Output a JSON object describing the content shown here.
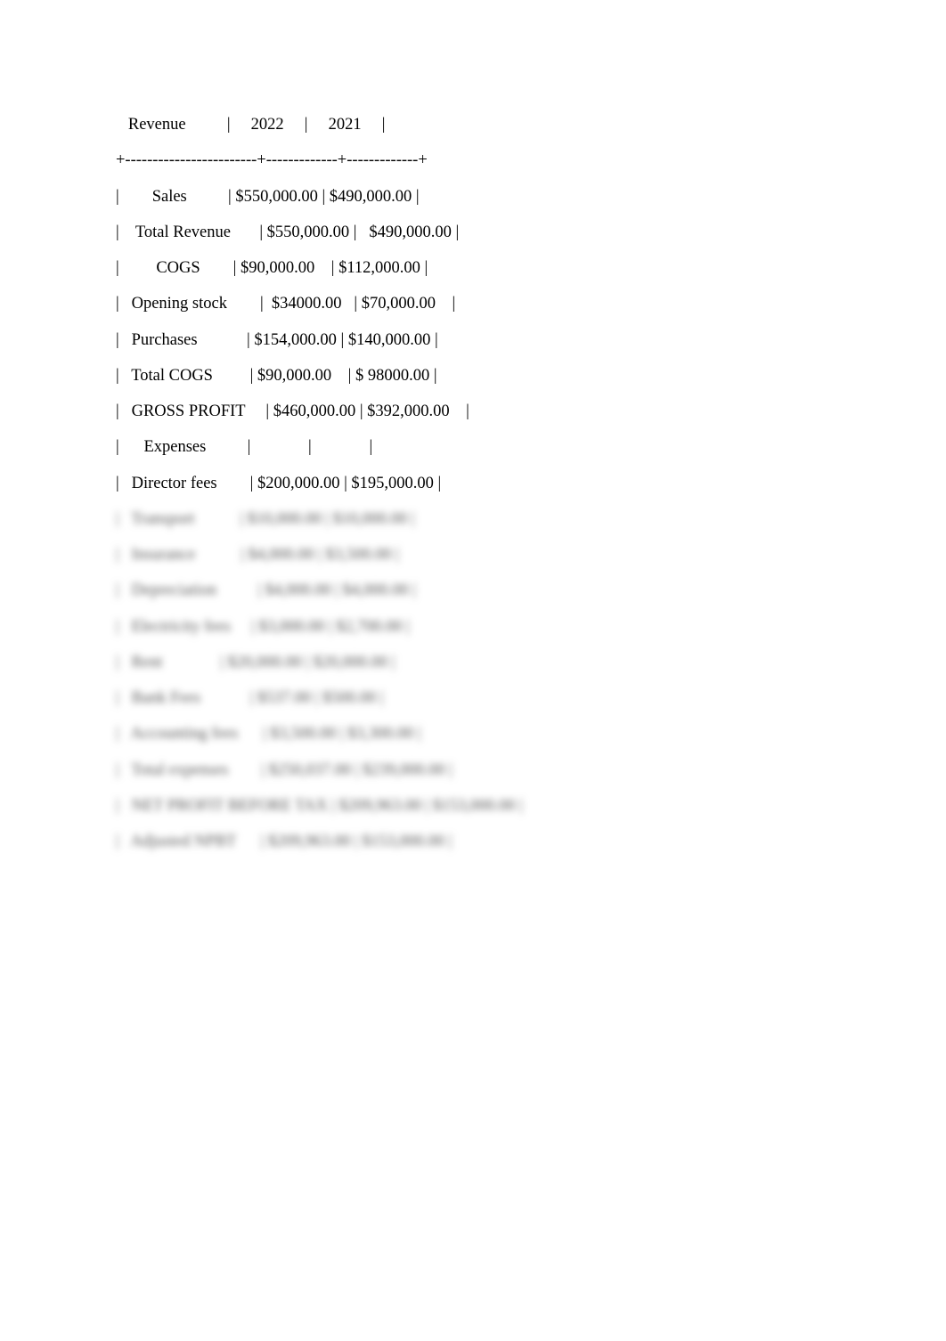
{
  "document": {
    "lines": [
      "   Revenue          |     2022     |     2021     |",
      "+------------------------+-------------+-------------+",
      "|        Sales          | $550,000.00 | $490,000.00 |",
      "|    Total Revenue       | $550,000.00 |   $490,000.00 |",
      "|         COGS        | $90,000.00    | $112,000.00 |",
      "|   Opening stock        |  $34000.00   | $70,000.00    |",
      "|   Purchases            | $154,000.00 | $140,000.00 |",
      "|   Total COGS         | $90,000.00    | $ 98000.00 |",
      "|   GROSS PROFIT     | $460,000.00 | $392,000.00    |",
      "|      Expenses          |              |              |",
      "|   Director fees        | $200,000.00 | $195,000.00 |"
    ],
    "blurred_lines": [
      "|   Transport           | $10,000.00 | $10,000.00 |",
      "|   Insurance           | $4,000.00 | $3,500.00 |",
      "|   Depreciation          | $4,000.00 | $4,000.00 |",
      "|   Electricity fees     | $3,000.00 | $2,700.00 |",
      "|   Rent              | $20,000.00 | $20,000.00 |",
      "|   Bank Fees            | $537.00 | $500.00 |",
      "|   Accounting fees      | $3,500.00 | $3,300.00 |",
      "|   Total expenses        | $250,037.00 | $239,000.00 |",
      "|   NET PROFIT BEFORE TAX | $209,963.00 | $153,000.00 |",
      "|   Adjusted NPBT      | $209,963.00 | $153,000.00 |"
    ]
  }
}
